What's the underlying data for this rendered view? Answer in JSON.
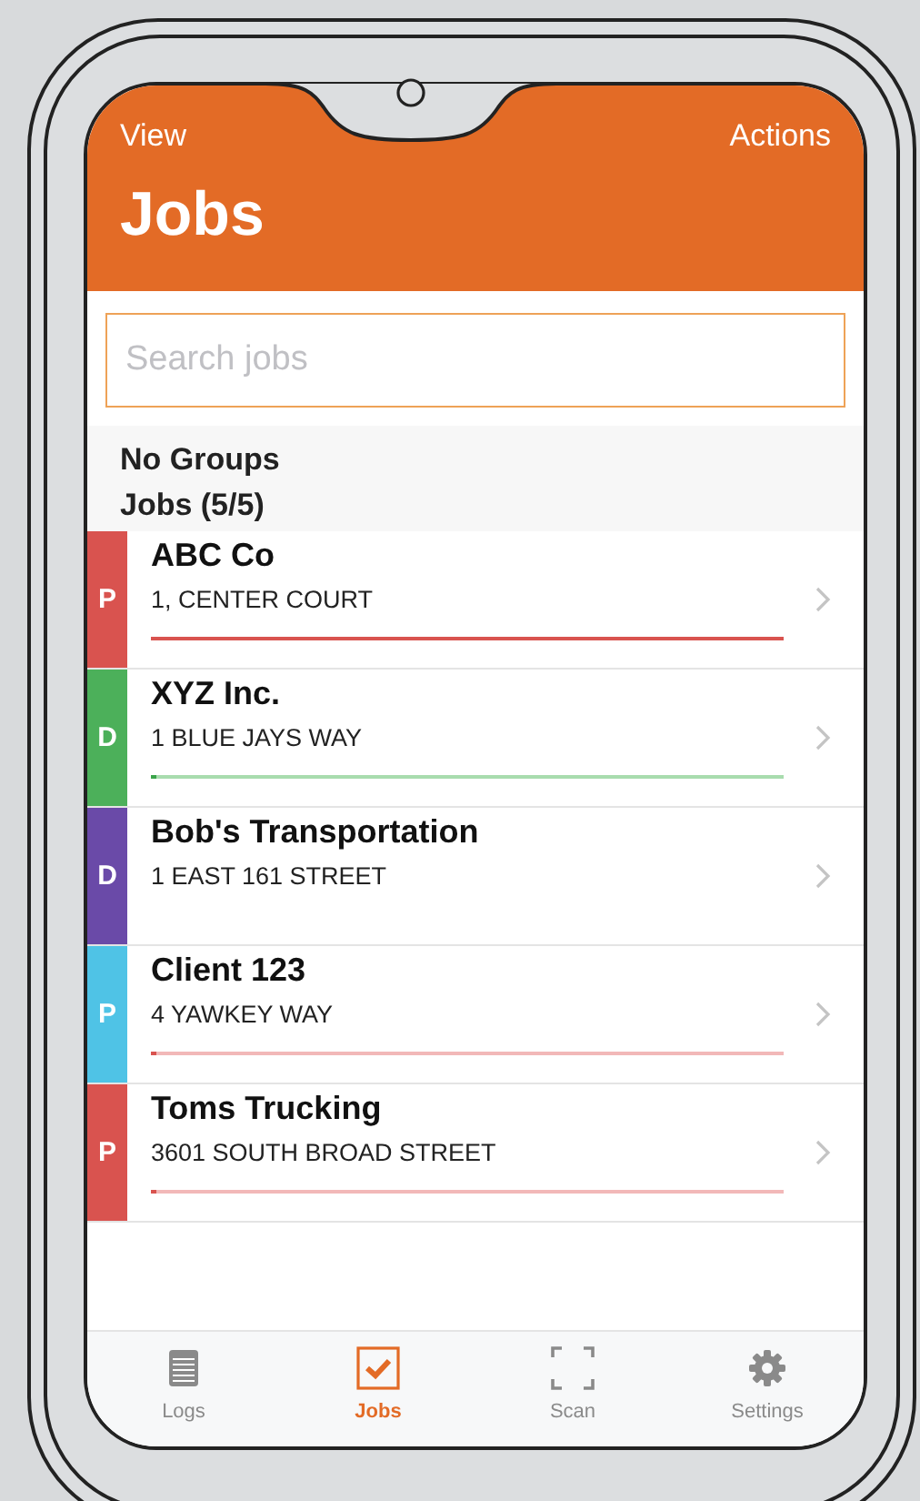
{
  "header": {
    "left_action": "View",
    "right_action": "Actions",
    "title": "Jobs"
  },
  "search": {
    "placeholder": "Search jobs"
  },
  "group_label": "No Groups",
  "list_label": "Jobs (5/5)",
  "jobs": [
    {
      "badge": "P",
      "color": "#d9534f",
      "name": "ABC Co",
      "address": "1, CENTER COURT",
      "progress": {
        "kind": "late",
        "level": 1
      }
    },
    {
      "badge": "D",
      "color": "#4cb05a",
      "name": "XYZ Inc.",
      "address": "1 BLUE JAYS WAY",
      "progress": {
        "kind": "on_track",
        "level": 0.01
      }
    },
    {
      "badge": "D",
      "color": "#6a4aa8",
      "name": "Bob's Transportation",
      "address": "1 EAST 161 STREET"
    },
    {
      "badge": "P",
      "color": "#4fc3e6",
      "name": "Client 123",
      "address": "4 YAWKEY WAY",
      "progress": {
        "kind": "late",
        "level": 0.01
      }
    },
    {
      "badge": "P",
      "color": "#d9534f",
      "name": "Toms Trucking",
      "address": "3601 SOUTH BROAD STREET",
      "progress": {
        "kind": "late",
        "level": 0.01
      }
    }
  ],
  "tabs": [
    {
      "kind": "logs",
      "label": "Logs",
      "selected": false
    },
    {
      "kind": "jobs",
      "label": "Jobs",
      "selected": true
    },
    {
      "kind": "scan",
      "label": "Scan",
      "selected": false
    },
    {
      "kind": "settings",
      "label": "Settings",
      "selected": false
    }
  ]
}
